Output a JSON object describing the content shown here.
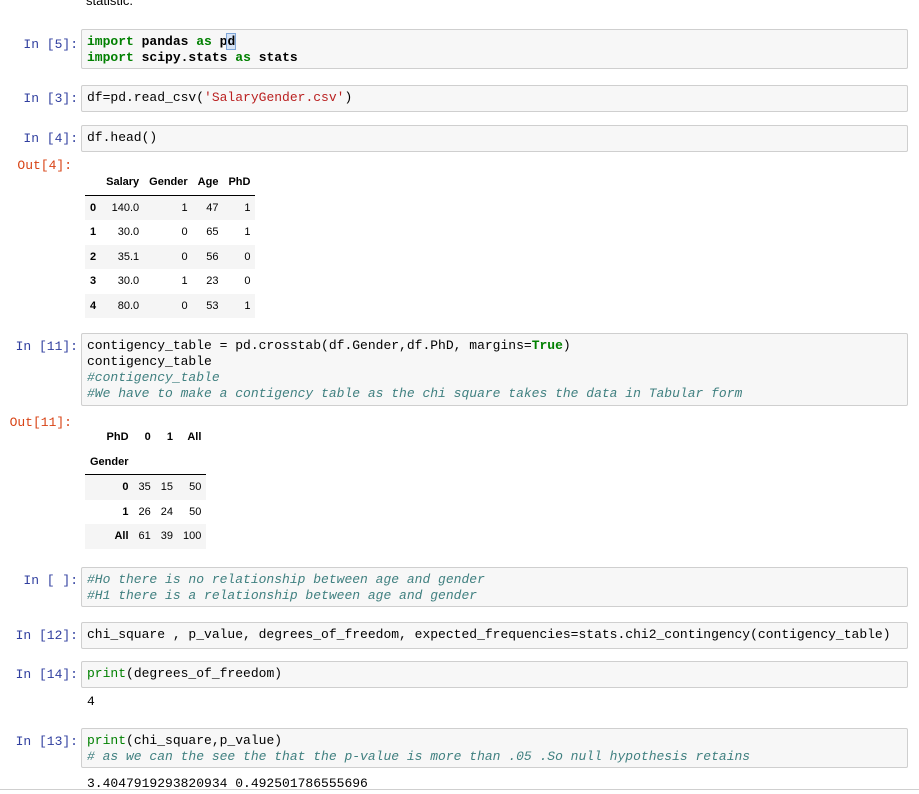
{
  "top_text": "statistic.",
  "cell1": {
    "prompt": "In [5]:"
  },
  "cell2": {
    "prompt": "In [3]:"
  },
  "cell3": {
    "prompt": "In [4]:",
    "out_prompt": "Out[4]:",
    "table": {
      "columns": [
        "",
        "Salary",
        "Gender",
        "Age",
        "PhD"
      ],
      "rows": [
        [
          "0",
          "140.0",
          "1",
          "47",
          "1"
        ],
        [
          "1",
          "30.0",
          "0",
          "65",
          "1"
        ],
        [
          "2",
          "35.1",
          "0",
          "56",
          "0"
        ],
        [
          "3",
          "30.0",
          "1",
          "23",
          "0"
        ],
        [
          "4",
          "80.0",
          "0",
          "53",
          "1"
        ]
      ]
    }
  },
  "cell4": {
    "prompt": "In [11]:",
    "out_prompt": "Out[11]:",
    "table": {
      "col_header": "PhD",
      "columns": [
        "0",
        "1",
        "All"
      ],
      "index_name": "Gender",
      "rows": [
        [
          "0",
          "35",
          "15",
          "50"
        ],
        [
          "1",
          "26",
          "24",
          "50"
        ],
        [
          "All",
          "61",
          "39",
          "100"
        ]
      ]
    }
  },
  "cell5": {
    "prompt": "In [ ]:",
    "line1": "#Ho there is no relationship between age and gender",
    "line2": "#H1 there is a relationship between age and gender"
  },
  "cell6": {
    "prompt": "In [12]:",
    "code": "chi_square , p_value, degrees_of_freedom, expected_frequencies=stats.chi2_contingency(contigency_table)"
  },
  "cell7": {
    "prompt": "In [14]:",
    "output": "4"
  },
  "cell8": {
    "prompt": "In [13]:",
    "comment": "# as we can the see the that the p-value is more than .05 .So null hypothesis retains",
    "output": "3.4047919293820934 0.492501786555696"
  }
}
